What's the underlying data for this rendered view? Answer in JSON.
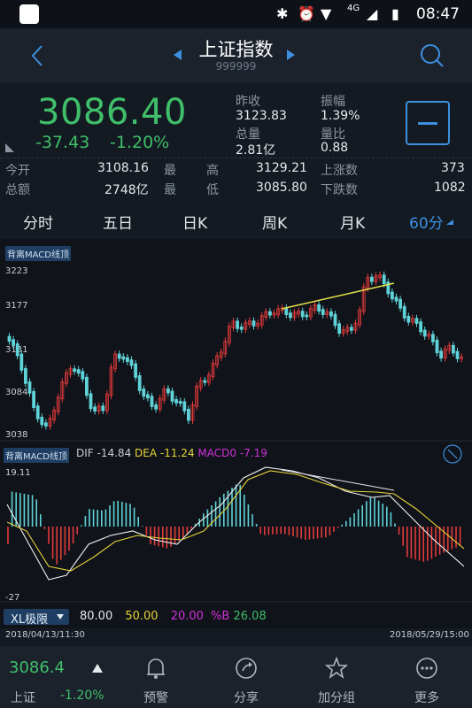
{
  "status_bar": {
    "time": "08:47",
    "network": "4G"
  },
  "header": {
    "title": "上证指数",
    "code": "999999"
  },
  "quote": {
    "price": "3086.40",
    "change": "-37.43",
    "change_pct": "-1.20%",
    "prev_close_label": "昨收",
    "prev_close": "3123.83",
    "amplitude_label": "振幅",
    "amplitude": "1.39%",
    "volume_label": "总量",
    "volume": "2.81亿",
    "volume_ratio_label": "量比",
    "volume_ratio": "0.88",
    "open_label": "今开",
    "open": "3108.16",
    "high_label": "最　高",
    "high": "3129.21",
    "up_label": "上涨数",
    "up_count": "373",
    "amount_label": "总额",
    "amount": "2748亿",
    "low_label": "最　低",
    "low": "3085.80",
    "down_label": "下跌数",
    "down_count": "1082"
  },
  "tabs": [
    {
      "label": "分时"
    },
    {
      "label": "五日"
    },
    {
      "label": "日K"
    },
    {
      "label": "周K"
    },
    {
      "label": "月K"
    },
    {
      "label": "60分"
    }
  ],
  "kline": {
    "tag": "背离MACD线顶",
    "y_ticks": [
      "3223",
      "3177",
      "3131",
      "3084",
      "3038"
    ]
  },
  "macd": {
    "tag": "背离MACD线顶",
    "dif_label": "DIF",
    "dif": "-14.84",
    "dea_label": "DEA",
    "dea": "-11.24",
    "macd_label": "MACD0",
    "macd": "-7.19",
    "y_top": "19.11",
    "y_bottom": "-27"
  },
  "indicator": {
    "name": "XL极限",
    "v1": "80.00",
    "v2": "50.00",
    "v3": "20.00",
    "b_label": "%B",
    "b_value": "26.08"
  },
  "dates": {
    "start": "2018/04/13/11:30",
    "end": "2018/05/29/15:00"
  },
  "bottom": {
    "index_price": "3086.4",
    "index_name": "上证",
    "index_pct": "-1.20%",
    "alert": "预警",
    "share": "分享",
    "add_group": "加分组",
    "more": "更多"
  },
  "colors": {
    "up": "#e23b3b",
    "down": "#5ed3d8",
    "green": "#3fbf6a",
    "accent": "#3d8fe0"
  }
}
